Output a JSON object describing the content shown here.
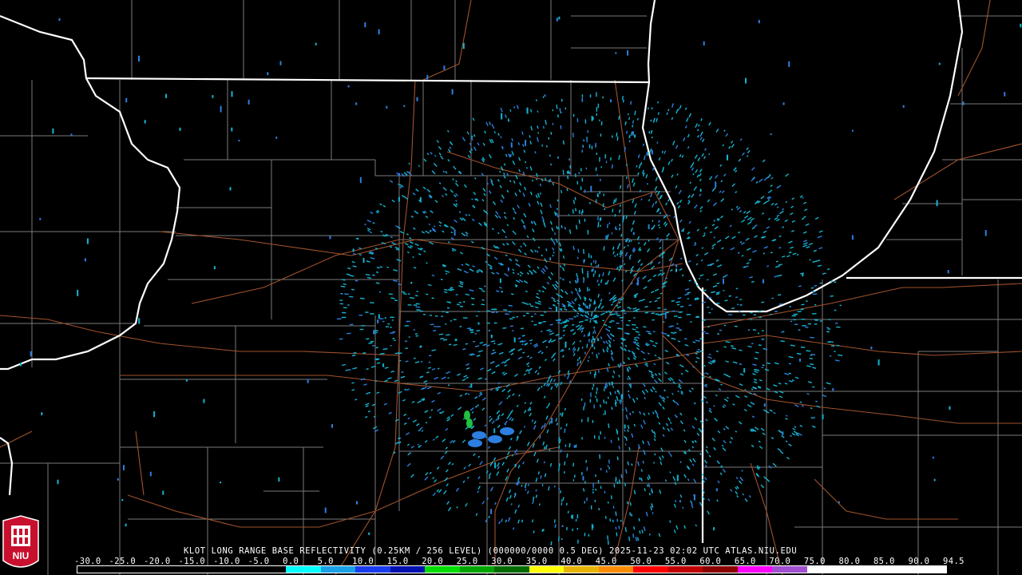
{
  "caption": {
    "station": "KLOT",
    "product": "LONG RANGE BASE REFLECTIVITY",
    "resolution": "(0.25KM / 256 LEVEL)",
    "code": "(000000/0000 0.5 DEG)",
    "timestamp": "2025-11-23 02:02 UTC",
    "source": "ATLAS.NIU.EDU",
    "full": "KLOT LONG RANGE BASE REFLECTIVITY (0.25KM / 256 LEVEL) (000000/0000 0.5 DEG) 2025-11-23 02:02 UTC  ATLAS.NIU.EDU"
  },
  "scale": {
    "labels": [
      "-30.0",
      "-25.0",
      "-20.0",
      "-15.0",
      "-10.0",
      "-5.0",
      "0.0",
      "5.0",
      "10.0",
      "15.0",
      "20.0",
      "25.0",
      "30.0",
      "35.0",
      "40.0",
      "45.0",
      "50.0",
      "55.0",
      "60.0",
      "65.0",
      "70.0",
      "75.0",
      "80.0",
      "85.0",
      "90.0",
      "94.5"
    ],
    "colors": [
      "#000000",
      "#000000",
      "#000000",
      "#000000",
      "#000000",
      "#000000",
      "#00ffff",
      "#19a0e6",
      "#1a3cf0",
      "#0010b0",
      "#00dd00",
      "#00a400",
      "#006a00",
      "#ffff00",
      "#e6b400",
      "#ff8c00",
      "#ff0000",
      "#c00000",
      "#8a0000",
      "#ff00ff",
      "#a050d0",
      "#ffffff",
      "#ffffff",
      "#ffffff",
      "#ffffff"
    ]
  },
  "logo": {
    "text": "NIU",
    "color": "#c8102e"
  },
  "colors": {
    "background": "#000000",
    "county": "#7a7a7a",
    "state": "#ffffff",
    "highway": "#a0522d",
    "echo_light": "#14b4d2",
    "echo_medium": "#2c7fe0",
    "echo_strong": "#22c040"
  }
}
